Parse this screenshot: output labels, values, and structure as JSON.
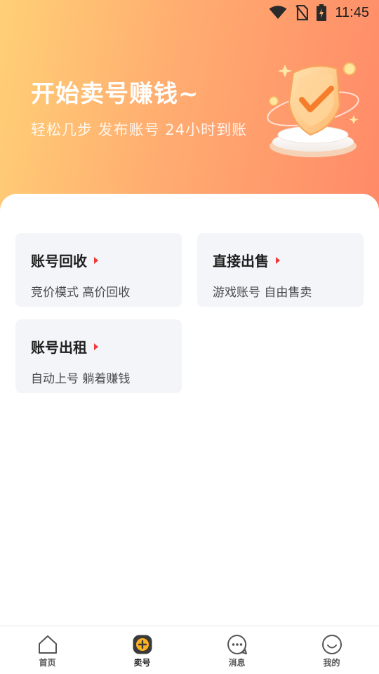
{
  "status_bar": {
    "time": "11:45",
    "icons": [
      "wifi-icon",
      "no-sim-icon",
      "battery-charging-icon"
    ]
  },
  "hero": {
    "title": "开始卖号赚钱~",
    "subtitle": "轻松几步 发布账号 24小时到账",
    "illustration": "shield-check-illustration"
  },
  "options": [
    {
      "title": "账号回收",
      "desc": "竞价模式 高价回收"
    },
    {
      "title": "直接出售",
      "desc": "游戏账号 自由售卖"
    },
    {
      "title": "账号出租",
      "desc": "自动上号 躺着赚钱"
    }
  ],
  "tabbar": {
    "active": "卖号",
    "tabs": [
      {
        "label": "首页",
        "icon": "home-icon"
      },
      {
        "label": "卖号",
        "icon": "sell-plus-icon"
      },
      {
        "label": "消息",
        "icon": "message-icon"
      },
      {
        "label": "我的",
        "icon": "profile-smile-icon"
      }
    ]
  },
  "colors": {
    "hero_start": "#ffd076",
    "hero_end": "#ff8a68",
    "arrow": "#f03a3a",
    "card_bg": "#f4f5f9"
  }
}
